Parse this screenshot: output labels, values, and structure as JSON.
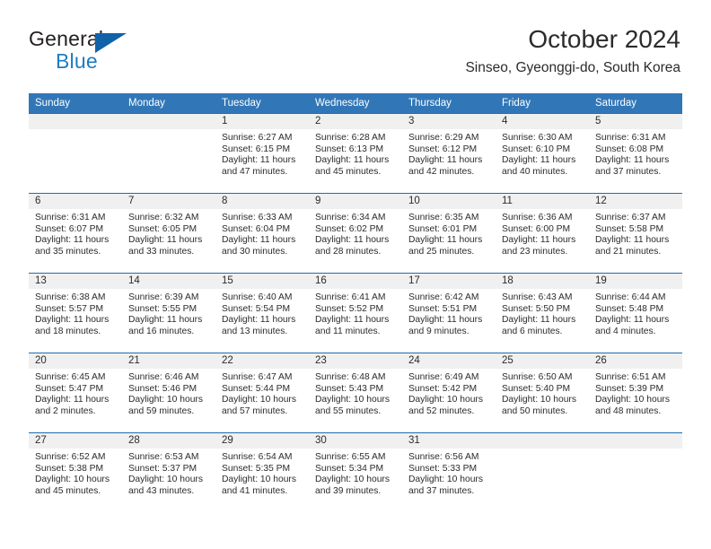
{
  "brand": {
    "name_line1": "General",
    "name_line2": "Blue",
    "triangle_icon": "triangle-icon",
    "accent_color": "#1f7cc0"
  },
  "header": {
    "title": "October 2024",
    "subtitle": "Sinseo, Gyeonggi-do, South Korea"
  },
  "colors": {
    "header_blue": "#3177b8",
    "row_divider": "#1f6cb0",
    "daynum_band": "#f0f0f0",
    "text": "#2b2b2b"
  },
  "weekdays": [
    "Sunday",
    "Monday",
    "Tuesday",
    "Wednesday",
    "Thursday",
    "Friday",
    "Saturday"
  ],
  "weeks": [
    [
      {
        "day": "",
        "sunrise": "",
        "sunset": "",
        "daylight_line1": "",
        "daylight_line2": ""
      },
      {
        "day": "",
        "sunrise": "",
        "sunset": "",
        "daylight_line1": "",
        "daylight_line2": ""
      },
      {
        "day": "1",
        "sunrise": "Sunrise: 6:27 AM",
        "sunset": "Sunset: 6:15 PM",
        "daylight_line1": "Daylight: 11 hours",
        "daylight_line2": "and 47 minutes."
      },
      {
        "day": "2",
        "sunrise": "Sunrise: 6:28 AM",
        "sunset": "Sunset: 6:13 PM",
        "daylight_line1": "Daylight: 11 hours",
        "daylight_line2": "and 45 minutes."
      },
      {
        "day": "3",
        "sunrise": "Sunrise: 6:29 AM",
        "sunset": "Sunset: 6:12 PM",
        "daylight_line1": "Daylight: 11 hours",
        "daylight_line2": "and 42 minutes."
      },
      {
        "day": "4",
        "sunrise": "Sunrise: 6:30 AM",
        "sunset": "Sunset: 6:10 PM",
        "daylight_line1": "Daylight: 11 hours",
        "daylight_line2": "and 40 minutes."
      },
      {
        "day": "5",
        "sunrise": "Sunrise: 6:31 AM",
        "sunset": "Sunset: 6:08 PM",
        "daylight_line1": "Daylight: 11 hours",
        "daylight_line2": "and 37 minutes."
      }
    ],
    [
      {
        "day": "6",
        "sunrise": "Sunrise: 6:31 AM",
        "sunset": "Sunset: 6:07 PM",
        "daylight_line1": "Daylight: 11 hours",
        "daylight_line2": "and 35 minutes."
      },
      {
        "day": "7",
        "sunrise": "Sunrise: 6:32 AM",
        "sunset": "Sunset: 6:05 PM",
        "daylight_line1": "Daylight: 11 hours",
        "daylight_line2": "and 33 minutes."
      },
      {
        "day": "8",
        "sunrise": "Sunrise: 6:33 AM",
        "sunset": "Sunset: 6:04 PM",
        "daylight_line1": "Daylight: 11 hours",
        "daylight_line2": "and 30 minutes."
      },
      {
        "day": "9",
        "sunrise": "Sunrise: 6:34 AM",
        "sunset": "Sunset: 6:02 PM",
        "daylight_line1": "Daylight: 11 hours",
        "daylight_line2": "and 28 minutes."
      },
      {
        "day": "10",
        "sunrise": "Sunrise: 6:35 AM",
        "sunset": "Sunset: 6:01 PM",
        "daylight_line1": "Daylight: 11 hours",
        "daylight_line2": "and 25 minutes."
      },
      {
        "day": "11",
        "sunrise": "Sunrise: 6:36 AM",
        "sunset": "Sunset: 6:00 PM",
        "daylight_line1": "Daylight: 11 hours",
        "daylight_line2": "and 23 minutes."
      },
      {
        "day": "12",
        "sunrise": "Sunrise: 6:37 AM",
        "sunset": "Sunset: 5:58 PM",
        "daylight_line1": "Daylight: 11 hours",
        "daylight_line2": "and 21 minutes."
      }
    ],
    [
      {
        "day": "13",
        "sunrise": "Sunrise: 6:38 AM",
        "sunset": "Sunset: 5:57 PM",
        "daylight_line1": "Daylight: 11 hours",
        "daylight_line2": "and 18 minutes."
      },
      {
        "day": "14",
        "sunrise": "Sunrise: 6:39 AM",
        "sunset": "Sunset: 5:55 PM",
        "daylight_line1": "Daylight: 11 hours",
        "daylight_line2": "and 16 minutes."
      },
      {
        "day": "15",
        "sunrise": "Sunrise: 6:40 AM",
        "sunset": "Sunset: 5:54 PM",
        "daylight_line1": "Daylight: 11 hours",
        "daylight_line2": "and 13 minutes."
      },
      {
        "day": "16",
        "sunrise": "Sunrise: 6:41 AM",
        "sunset": "Sunset: 5:52 PM",
        "daylight_line1": "Daylight: 11 hours",
        "daylight_line2": "and 11 minutes."
      },
      {
        "day": "17",
        "sunrise": "Sunrise: 6:42 AM",
        "sunset": "Sunset: 5:51 PM",
        "daylight_line1": "Daylight: 11 hours",
        "daylight_line2": "and 9 minutes."
      },
      {
        "day": "18",
        "sunrise": "Sunrise: 6:43 AM",
        "sunset": "Sunset: 5:50 PM",
        "daylight_line1": "Daylight: 11 hours",
        "daylight_line2": "and 6 minutes."
      },
      {
        "day": "19",
        "sunrise": "Sunrise: 6:44 AM",
        "sunset": "Sunset: 5:48 PM",
        "daylight_line1": "Daylight: 11 hours",
        "daylight_line2": "and 4 minutes."
      }
    ],
    [
      {
        "day": "20",
        "sunrise": "Sunrise: 6:45 AM",
        "sunset": "Sunset: 5:47 PM",
        "daylight_line1": "Daylight: 11 hours",
        "daylight_line2": "and 2 minutes."
      },
      {
        "day": "21",
        "sunrise": "Sunrise: 6:46 AM",
        "sunset": "Sunset: 5:46 PM",
        "daylight_line1": "Daylight: 10 hours",
        "daylight_line2": "and 59 minutes."
      },
      {
        "day": "22",
        "sunrise": "Sunrise: 6:47 AM",
        "sunset": "Sunset: 5:44 PM",
        "daylight_line1": "Daylight: 10 hours",
        "daylight_line2": "and 57 minutes."
      },
      {
        "day": "23",
        "sunrise": "Sunrise: 6:48 AM",
        "sunset": "Sunset: 5:43 PM",
        "daylight_line1": "Daylight: 10 hours",
        "daylight_line2": "and 55 minutes."
      },
      {
        "day": "24",
        "sunrise": "Sunrise: 6:49 AM",
        "sunset": "Sunset: 5:42 PM",
        "daylight_line1": "Daylight: 10 hours",
        "daylight_line2": "and 52 minutes."
      },
      {
        "day": "25",
        "sunrise": "Sunrise: 6:50 AM",
        "sunset": "Sunset: 5:40 PM",
        "daylight_line1": "Daylight: 10 hours",
        "daylight_line2": "and 50 minutes."
      },
      {
        "day": "26",
        "sunrise": "Sunrise: 6:51 AM",
        "sunset": "Sunset: 5:39 PM",
        "daylight_line1": "Daylight: 10 hours",
        "daylight_line2": "and 48 minutes."
      }
    ],
    [
      {
        "day": "27",
        "sunrise": "Sunrise: 6:52 AM",
        "sunset": "Sunset: 5:38 PM",
        "daylight_line1": "Daylight: 10 hours",
        "daylight_line2": "and 45 minutes."
      },
      {
        "day": "28",
        "sunrise": "Sunrise: 6:53 AM",
        "sunset": "Sunset: 5:37 PM",
        "daylight_line1": "Daylight: 10 hours",
        "daylight_line2": "and 43 minutes."
      },
      {
        "day": "29",
        "sunrise": "Sunrise: 6:54 AM",
        "sunset": "Sunset: 5:35 PM",
        "daylight_line1": "Daylight: 10 hours",
        "daylight_line2": "and 41 minutes."
      },
      {
        "day": "30",
        "sunrise": "Sunrise: 6:55 AM",
        "sunset": "Sunset: 5:34 PM",
        "daylight_line1": "Daylight: 10 hours",
        "daylight_line2": "and 39 minutes."
      },
      {
        "day": "31",
        "sunrise": "Sunrise: 6:56 AM",
        "sunset": "Sunset: 5:33 PM",
        "daylight_line1": "Daylight: 10 hours",
        "daylight_line2": "and 37 minutes."
      },
      {
        "day": "",
        "sunrise": "",
        "sunset": "",
        "daylight_line1": "",
        "daylight_line2": ""
      },
      {
        "day": "",
        "sunrise": "",
        "sunset": "",
        "daylight_line1": "",
        "daylight_line2": ""
      }
    ]
  ]
}
